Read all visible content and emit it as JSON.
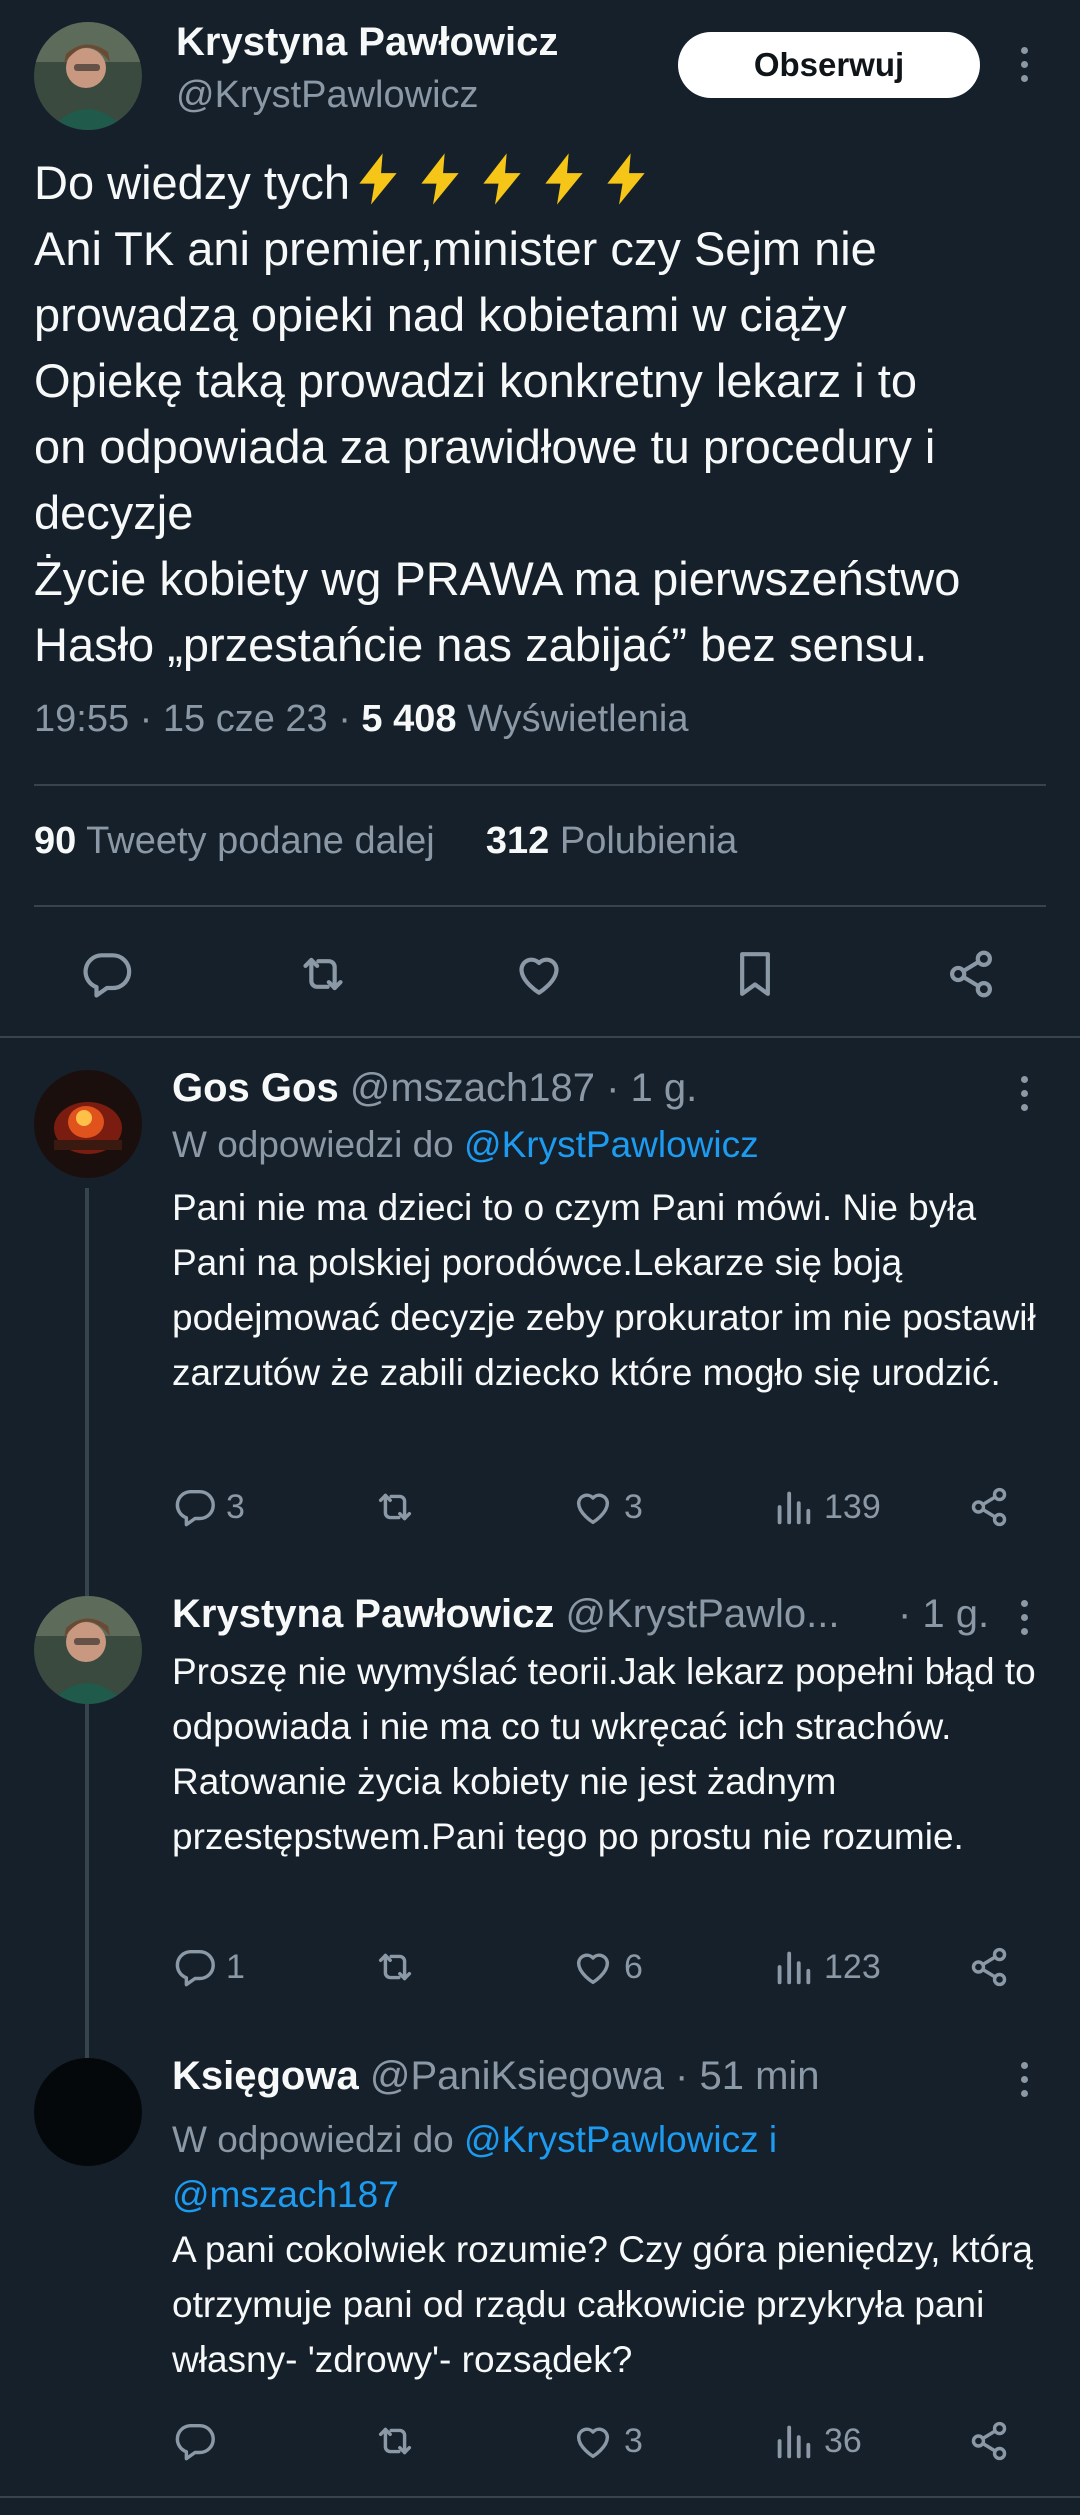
{
  "main": {
    "name": "Krystyna Pawłowicz",
    "handle": "@KrystPawlowicz",
    "follow_label": "Obserwuj",
    "text_line1": "Do wiedzy tych",
    "text_rest": "Ani TK ani premier,minister czy Sejm  nie\nprowadzą opieki nad kobietami w ciąży\nOpiekę taką prowadzi konkretny lekarz i to\non odpowiada za prawidłowe tu procedury i\ndecyzje\nŻycie kobiety wg PRAWA ma pierwszeństwo\nHasło „przestańcie nas zabijać” bez sensu.",
    "time": "19:55 · 15 cze 23 · ",
    "views_count": "5 408",
    "views_label": "Wyświetlenia",
    "retweets_count": "90",
    "retweets_label": "Tweety podane dalej",
    "likes_count": "312",
    "likes_label": "Polubienia",
    "icons": [
      "reply-icon",
      "retweet-icon",
      "like-icon",
      "bookmark-icon",
      "share-icon"
    ]
  },
  "replies": [
    {
      "name": "Gos Gos",
      "handle": "@mszach187 · 1 g.",
      "reply_to_prefix": "W odpowiedzi do ",
      "reply_to": "@KrystPawlowicz",
      "text": "Pani nie ma dzieci to o czym Pani mówi. Nie była Pani na polskiej porodówce.Lekarze się boją podejmować decyzje zeby prokurator im nie postawił zarzutów że zabili dziecko które mogło się urodzić.",
      "replies": "3",
      "retweets": "",
      "likes": "3",
      "views": "139"
    },
    {
      "name": "Krystyna Pawłowicz",
      "handle": "@KrystPawlo...",
      "time": "· 1 g.",
      "text": "Proszę nie wymyślać teorii.Jak lekarz popełni błąd to odpowiada i nie ma co tu wkręcać ich strachów. Ratowanie życia kobiety nie jest żadnym przestępstwem.Pani tego po prostu nie rozumie.",
      "replies": "1",
      "retweets": "",
      "likes": "6",
      "views": "123"
    },
    {
      "name": "Księgowa",
      "handle": "@PaniKsiegowa · 51 min",
      "reply_to_prefix": "W odpowiedzi do ",
      "reply_to": "@KrystPawlowicz i",
      "reply_to2": "@mszach187",
      "text": "A pani cokolwiek rozumie? Czy góra pieniędzy, którą otrzymuje pani od rządu całkowicie przykryła pani własny- 'zdrowy'- rozsądek?",
      "replies": "",
      "retweets": "",
      "likes": "3",
      "views": "36"
    }
  ],
  "colors": {
    "background": "#15202b",
    "text": "#f7f9f9",
    "muted": "#8b98a5",
    "link": "#1d9bf0",
    "divider": "#38444d",
    "bolt": "#f5c518"
  }
}
